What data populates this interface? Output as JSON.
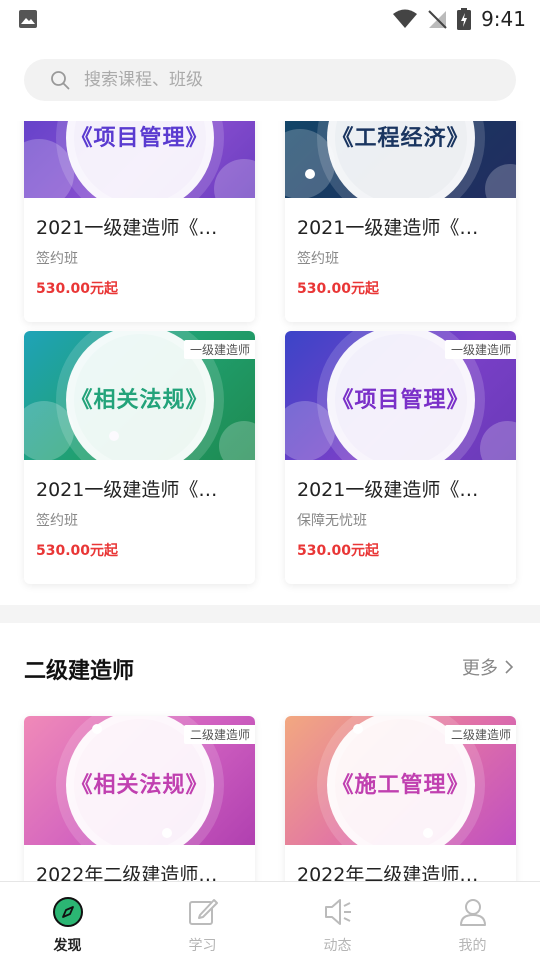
{
  "status_bar": {
    "time": "9:41"
  },
  "search": {
    "placeholder": "搜索课程、班级"
  },
  "section1": {
    "courses": [
      {
        "name": "2021一级建造师《…",
        "class_type": "签约班",
        "price": "530.00元起",
        "thumb_title": "《项目管理》",
        "tag": ""
      },
      {
        "name": "2021一级建造师《…",
        "class_type": "签约班",
        "price": "530.00元起",
        "thumb_title": "《工程经济》",
        "tag": ""
      },
      {
        "name": "2021一级建造师《…",
        "class_type": "签约班",
        "price": "530.00元起",
        "thumb_title": "《相关法规》",
        "tag": "一级建造师"
      },
      {
        "name": "2021一级建造师《…",
        "class_type": "保障无忧班",
        "price": "530.00元起",
        "thumb_title": "《项目管理》",
        "tag": "一级建造师"
      }
    ]
  },
  "section2": {
    "title": "二级建造师",
    "more_label": "更多",
    "courses": [
      {
        "name": "2022年二级建造师…",
        "thumb_title": "《相关法规》",
        "tag": "二级建造师"
      },
      {
        "name": "2022年二级建造师…",
        "thumb_title": "《施工管理》",
        "tag": "二级建造师"
      }
    ]
  },
  "bottom_nav": {
    "items": [
      {
        "label": "发现",
        "icon": "compass-icon",
        "active": true
      },
      {
        "label": "学习",
        "icon": "edit-icon",
        "active": false
      },
      {
        "label": "动态",
        "icon": "speaker-icon",
        "active": false
      },
      {
        "label": "我的",
        "icon": "person-icon",
        "active": false
      }
    ]
  },
  "colors": {
    "price": "#e93636",
    "active_nav": "#2bb673"
  }
}
